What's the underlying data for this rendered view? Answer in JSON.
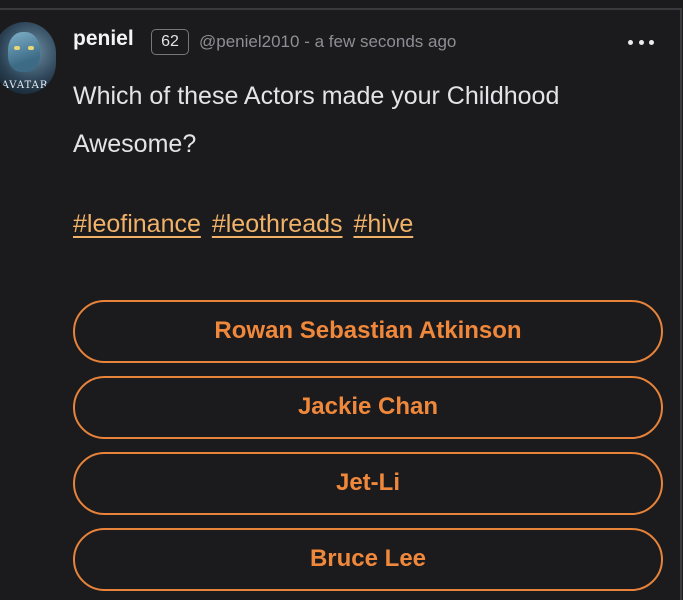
{
  "post": {
    "avatar_label": "AVATAR",
    "username": "peniel",
    "reputation": "62",
    "handle": "@peniel2010",
    "separator": "-",
    "time": "a few seconds ago",
    "body": "Which of these Actors made your Childhood Awesome?",
    "tags": [
      "#leofinance",
      "#leothreads",
      "#hive"
    ],
    "more_icon": "ellipsis-icon"
  },
  "poll": {
    "options": [
      "Rowan Sebastian Atkinson",
      "Jackie Chan",
      "Jet-Li",
      "Bruce Lee"
    ]
  },
  "colors": {
    "background": "#1b1a1d",
    "accent": "#e8833a",
    "tag": "#f0b169",
    "text": "#e4e4e8",
    "muted": "#8f8e94"
  }
}
